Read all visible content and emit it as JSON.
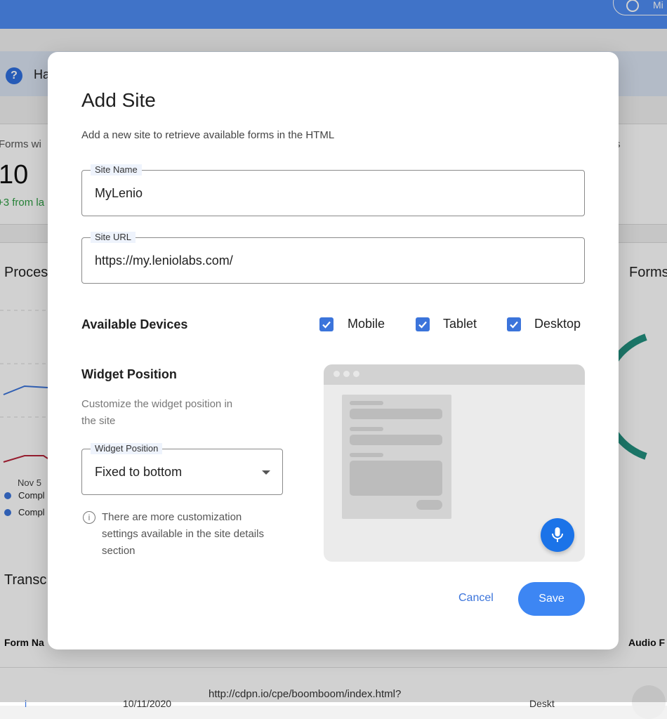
{
  "background": {
    "user_menu": {
      "name": "Mi"
    },
    "help_banner": {
      "text": "Ha"
    },
    "stats": {
      "label_left": "Forms wi",
      "value": "10",
      "delta": "+3 from la",
      "label_right": "s"
    },
    "chart": {
      "title": "Proces",
      "title_right": "Forms",
      "axis_label": "Nov 5",
      "legend": [
        "Compl",
        "Compl"
      ]
    },
    "table": {
      "title": "Transc",
      "header_left": "Form Na",
      "header_right": "Audio F",
      "row": {
        "name": "i",
        "date": "10/11/2020",
        "url": "http://cdpn.io/cpe/boomboom/index.html?",
        "device": "Deskt"
      }
    }
  },
  "modal": {
    "title": "Add Site",
    "subtitle": "Add a new site to retrieve available forms in the HTML",
    "site_name": {
      "label": "Site Name",
      "value": "MyLenio"
    },
    "site_url": {
      "label": "Site URL",
      "value": "https://my.leniolabs.com/"
    },
    "devices": {
      "label": "Available Devices",
      "options": [
        {
          "label": "Mobile",
          "checked": true
        },
        {
          "label": "Tablet",
          "checked": true
        },
        {
          "label": "Desktop",
          "checked": true
        }
      ]
    },
    "widget_position": {
      "heading": "Widget Position",
      "description": "Customize the widget position in the site",
      "select": {
        "label": "Widget Position",
        "value": "Fixed to bottom"
      },
      "info": "There are more customization settings available in the site details section"
    },
    "preview": {
      "mic_icon": "microphone-icon"
    },
    "actions": {
      "cancel": "Cancel",
      "save": "Save"
    }
  },
  "colors": {
    "accent": "#3b74db",
    "primary_button": "#3d86f3",
    "topbar": "#4f8df5",
    "mic_button": "#1b73e8"
  }
}
